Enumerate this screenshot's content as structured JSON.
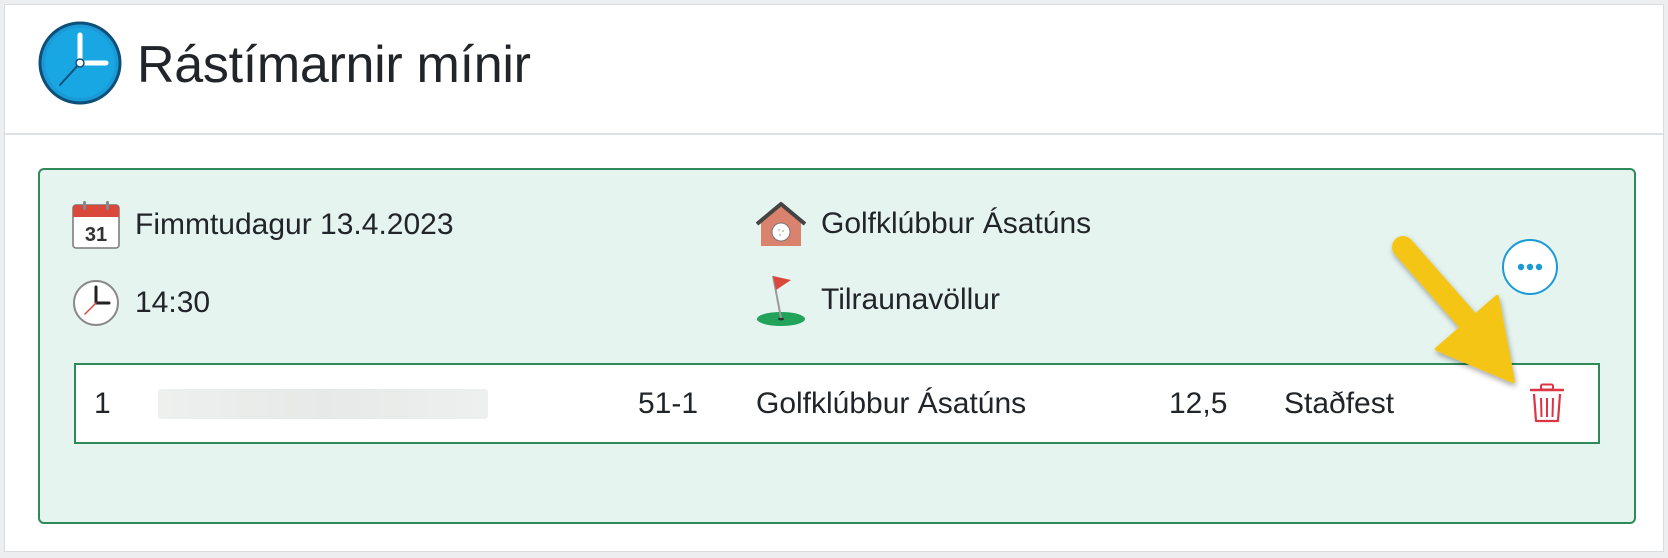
{
  "header": {
    "title": "Rástímarnir mínir",
    "icon": "clock-icon"
  },
  "booking": {
    "date": "Fimmtudagur 13.4.2023",
    "date_icon": "calendar-icon",
    "calendar_day": "31",
    "time": "14:30",
    "time_icon": "clock-icon",
    "club": "Golfklúbbur Ásatúns",
    "club_icon": "clubhouse-icon",
    "course": "Tilraunavöllur",
    "course_icon": "golf-flag-icon",
    "more_icon": "ellipsis-icon",
    "players": [
      {
        "number": "1",
        "name": "",
        "member_id": "51-1",
        "club": "Golfklúbbur Ásatúns",
        "handicap": "12,5",
        "status": "Staðfest",
        "action_icon": "trash-icon"
      }
    ]
  },
  "colors": {
    "accent": "#1a9bd7",
    "booking_bg": "#e6f4f0",
    "booking_border": "#2e8b57",
    "delete": "#dc3545",
    "annotation_arrow": "#f5c518"
  }
}
